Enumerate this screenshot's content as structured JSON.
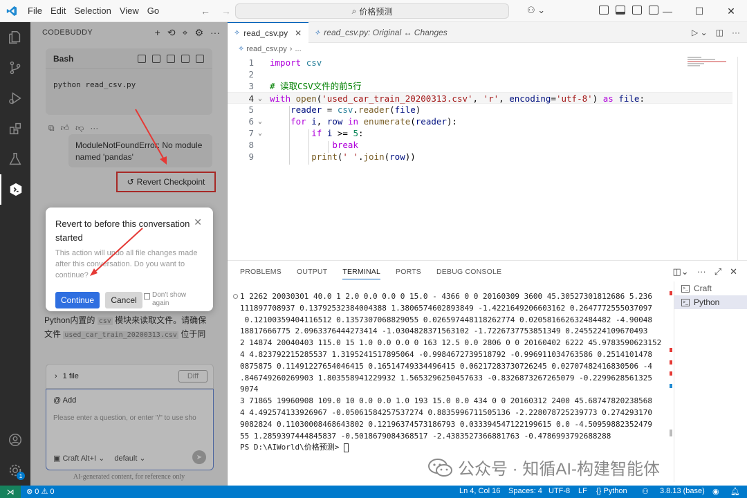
{
  "titlebar": {
    "menus": [
      "File",
      "Edit",
      "Selection",
      "View",
      "Go"
    ],
    "search_text": "价格预测"
  },
  "sidebar": {
    "title": "CODEBUDDY",
    "bash_title": "Bash",
    "bash_command": "python read_csv.py",
    "error_text": "ModuleNotFoundError: No module named 'pandas'",
    "revert_label": "Revert Checkpoint",
    "under_line1": "Python内置的",
    "under_code1": "csv",
    "under_line1b": "模块来读取文件。请确保",
    "under_line2a": "文件",
    "under_code2": "used_car_train_20200313.csv",
    "under_line2b": "位于同",
    "file_card_label": "1 file",
    "diff_label": "Diff",
    "add_label": "@ Add",
    "input_placeholder": "Please enter a question, or enter \"/\" to use sho",
    "mode_label": "Craft Alt+I",
    "model_label": "default",
    "disclaimer": "AI-generated content, for reference only"
  },
  "dialog": {
    "title": "Revert to before this conversation started",
    "body": "This action will undo all file changes made after this conversation. Do you want to continue?",
    "continue_label": "Continue",
    "cancel_label": "Cancel",
    "dont_show_label": "Don't show again"
  },
  "editor": {
    "tab_active": "read_csv.py",
    "tab_diff": "read_csv.py: Original ↔ Changes",
    "breadcrumb_file": "read_csv.py",
    "breadcrumb_rest": "..."
  },
  "panel": {
    "tabs": [
      "PROBLEMS",
      "OUTPUT",
      "TERMINAL",
      "PORTS",
      "DEBUG CONSOLE"
    ],
    "terminal_lines": [
      "1 2262 20030301 40.0 1 2.0 0.0 0.0 0 15.0 - 4366 0 0 20160309 3600 45.30527301812686 5.236",
      "111897708937 0.13792532384004388 1.3806574602893849 -1.4221649206603162 0.2647772555037097",
      " 0.12100359404116512 0.1357307068829055 0.026597448118262774 0.020581662632484482 -4.90048",
      "18817666775 2.0963376444273414 -1.0304828371563102 -1.7226737753851349 0.2455224109670493",
      "2 14874 20040403 115.0 15 1.0 0.0 0.0 0 163 12.5 0.0 2806 0 0 20160402 6222 45.9783590623152",
      "4 4.823792215285537 1.3195241517895064 -0.9984672739518792 -0.996911034763586 0.2514101478",
      "0875875 0.11491227654046415 0.16514749334496415 0.06217283730726245 0.02707482416830506 -4",
      ".846749260269903 1.803558941229932 1.5653296250457633 -0.8326873267265079 -0.2299628561325",
      "9074",
      "3 71865 19960908 109.0 10 0.0 0.0 1.0 193 15.0 0.0 434 0 0 20160312 2400 45.68747820238568",
      "4 4.492574133926967 -0.05061584257537274 0.8835996711505136 -2.228078725239773 0.274293170",
      "9082824 0.11030008468643802 0.12196374573186793 0.033394547122199615 0.0 -4.50959882352479",
      "55 1.2859397444845837 -0.5018679084368517 -2.4383527366881763 -0.4786993792688288",
      "PS D:\\AIWorld\\价格预测> "
    ],
    "terminals": [
      "Craft",
      "Python"
    ]
  },
  "status": {
    "problems": "⊗ 0 ⚠ 0",
    "position": "Ln 4, Col 16",
    "spaces": "Spaces: 4",
    "encoding": "UTF-8",
    "eol": "LF",
    "language": "{} Python",
    "python_env": "3.8.13 (base)"
  },
  "watermark": {
    "text": "公众号 · 知循AI-构建智能体"
  },
  "colors": {
    "accent": "#007acc",
    "highlight_red": "#e53935",
    "button_blue": "#2f6fe0"
  }
}
